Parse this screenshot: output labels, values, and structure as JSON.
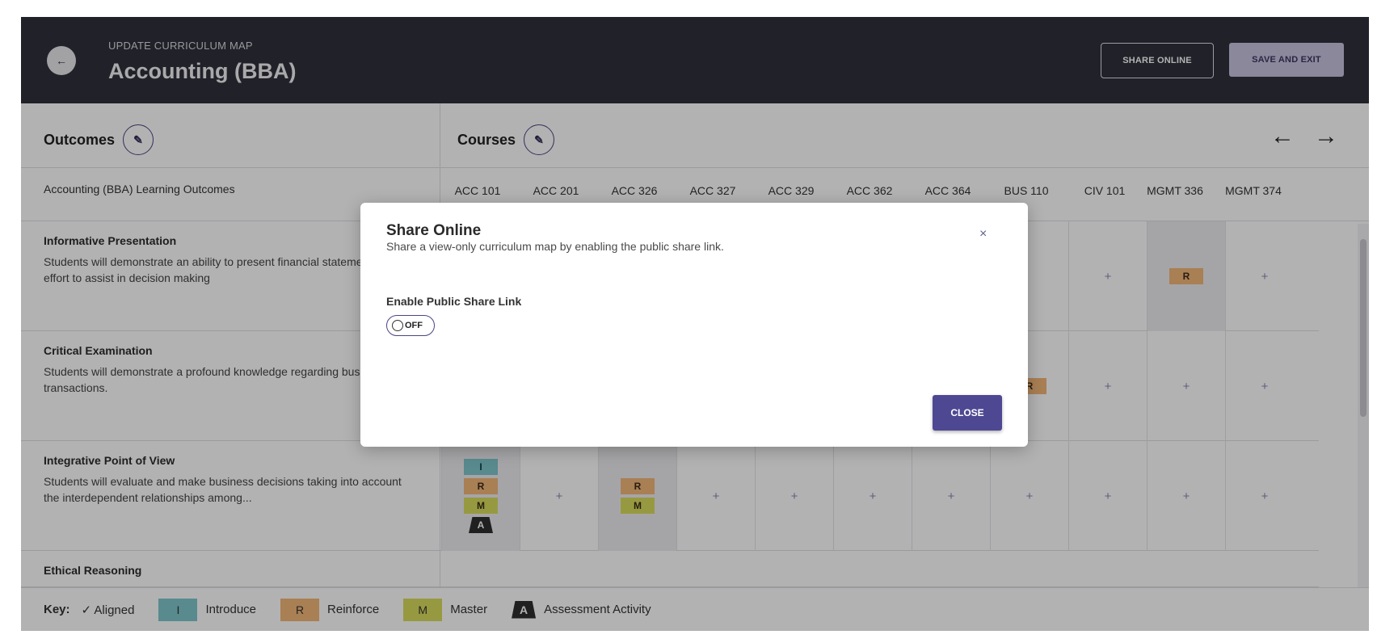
{
  "header": {
    "back_icon": "arrow-left-icon",
    "subtitle": "UPDATE CURRICULUM MAP",
    "title": "Accounting (BBA)",
    "share_label": "SHARE ONLINE",
    "save_label": "SAVE AND EXIT"
  },
  "sections": {
    "outcomes_label": "Outcomes",
    "courses_label": "Courses",
    "prev_arrow": "←",
    "next_arrow": "→"
  },
  "table": {
    "outcomes_header": "Accounting (BBA) Learning Outcomes",
    "courses": [
      "ACC 101",
      "ACC 201",
      "ACC 326",
      "ACC 327",
      "ACC 329",
      "ACC 362",
      "ACC 364",
      "BUS 110",
      "CIV 101",
      "MGMT 336",
      "MGMT 374"
    ],
    "rows": [
      {
        "title": "Informative Presentation",
        "desc": "Students will demonstrate an ability to present financial statements in an effort to assist in decision making"
      },
      {
        "title": "Critical Examination",
        "desc": "Students will demonstrate a profound knowledge regarding business transactions."
      },
      {
        "title": "Integrative Point of View",
        "desc": "Students will evaluate and make business decisions taking into account the interdependent relationships among..."
      },
      {
        "title": "Ethical Reasoning",
        "desc": ""
      }
    ],
    "plus": "+",
    "chip_i": "I",
    "chip_r": "R",
    "chip_m": "M",
    "chip_a": "A"
  },
  "key": {
    "label": "Key:",
    "aligned": "✓ Aligned",
    "introduce_chip": "I",
    "introduce": "Introduce",
    "reinforce_chip": "R",
    "reinforce": "Reinforce",
    "master_chip": "M",
    "master": "Master",
    "assessment_chip": "A",
    "assessment": "Assessment Activity"
  },
  "modal": {
    "title": "Share Online",
    "description": "Share a view-only curriculum map by enabling the public share link.",
    "close_x": "×",
    "toggle_label": "Enable Public Share Link",
    "toggle_state": "OFF",
    "close_label": "CLOSE"
  },
  "colors": {
    "header_bg": "#2e303c",
    "accent": "#4e4893",
    "introduce": "#7fc6cc",
    "reinforce": "#f2b679",
    "master": "#d9dc5d"
  }
}
